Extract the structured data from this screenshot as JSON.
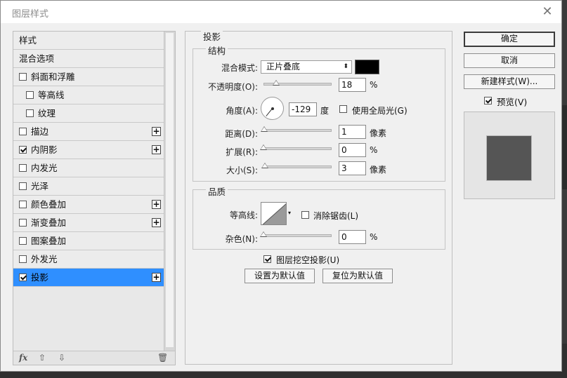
{
  "dialog": {
    "title": "图层样式"
  },
  "style_list": {
    "items": [
      {
        "label": "样式",
        "checkbox": false,
        "checked": false,
        "plus": false,
        "indent": false,
        "selected": false
      },
      {
        "label": "混合选项",
        "checkbox": false,
        "checked": false,
        "plus": false,
        "indent": false,
        "selected": false
      },
      {
        "label": "斜面和浮雕",
        "checkbox": true,
        "checked": false,
        "plus": false,
        "indent": false,
        "selected": false
      },
      {
        "label": "等高线",
        "checkbox": true,
        "checked": false,
        "plus": false,
        "indent": true,
        "selected": false
      },
      {
        "label": "纹理",
        "checkbox": true,
        "checked": false,
        "plus": false,
        "indent": true,
        "selected": false
      },
      {
        "label": "描边",
        "checkbox": true,
        "checked": false,
        "plus": true,
        "indent": false,
        "selected": false
      },
      {
        "label": "内阴影",
        "checkbox": true,
        "checked": true,
        "plus": true,
        "indent": false,
        "selected": false
      },
      {
        "label": "内发光",
        "checkbox": true,
        "checked": false,
        "plus": false,
        "indent": false,
        "selected": false
      },
      {
        "label": "光泽",
        "checkbox": true,
        "checked": false,
        "plus": false,
        "indent": false,
        "selected": false
      },
      {
        "label": "颜色叠加",
        "checkbox": true,
        "checked": false,
        "plus": true,
        "indent": false,
        "selected": false
      },
      {
        "label": "渐变叠加",
        "checkbox": true,
        "checked": false,
        "plus": true,
        "indent": false,
        "selected": false
      },
      {
        "label": "图案叠加",
        "checkbox": true,
        "checked": false,
        "plus": false,
        "indent": false,
        "selected": false
      },
      {
        "label": "外发光",
        "checkbox": true,
        "checked": false,
        "plus": false,
        "indent": false,
        "selected": false
      },
      {
        "label": "投影",
        "checkbox": true,
        "checked": true,
        "plus": true,
        "indent": false,
        "selected": true
      }
    ],
    "footer": {
      "fx": "fx",
      "up": "⇧",
      "down": "⇩",
      "trash": "🗑"
    }
  },
  "drop_shadow": {
    "section_title": "投影",
    "structure": {
      "title": "结构",
      "blend_mode_label": "混合模式:",
      "blend_mode_value": "正片叠底",
      "blend_color": "#000000",
      "opacity_label": "不透明度(O):",
      "opacity_value": "18",
      "opacity_unit": "%",
      "angle_label": "角度(A):",
      "angle_value": "-129",
      "angle_unit": "度",
      "global_light_label": "使用全局光(G)",
      "global_light_checked": false,
      "distance_label": "距离(D):",
      "distance_value": "1",
      "distance_unit": "像素",
      "spread_label": "扩展(R):",
      "spread_value": "0",
      "spread_unit": "%",
      "size_label": "大小(S):",
      "size_value": "3",
      "size_unit": "像素"
    },
    "quality": {
      "title": "品质",
      "contour_label": "等高线:",
      "antialias_label": "消除锯齿(L)",
      "antialias_checked": false,
      "noise_label": "杂色(N):",
      "noise_value": "0",
      "noise_unit": "%"
    },
    "knockout_label": "图层挖空投影(U)",
    "knockout_checked": true,
    "make_default_label": "设置为默认值",
    "reset_default_label": "复位为默认值"
  },
  "buttons": {
    "ok": "确定",
    "cancel": "取消",
    "new_style": "新建样式(W)...",
    "preview_label": "预览(V)",
    "preview_checked": true
  },
  "colors": {
    "selection": "#2f8fff",
    "preview_square": "#555555"
  }
}
